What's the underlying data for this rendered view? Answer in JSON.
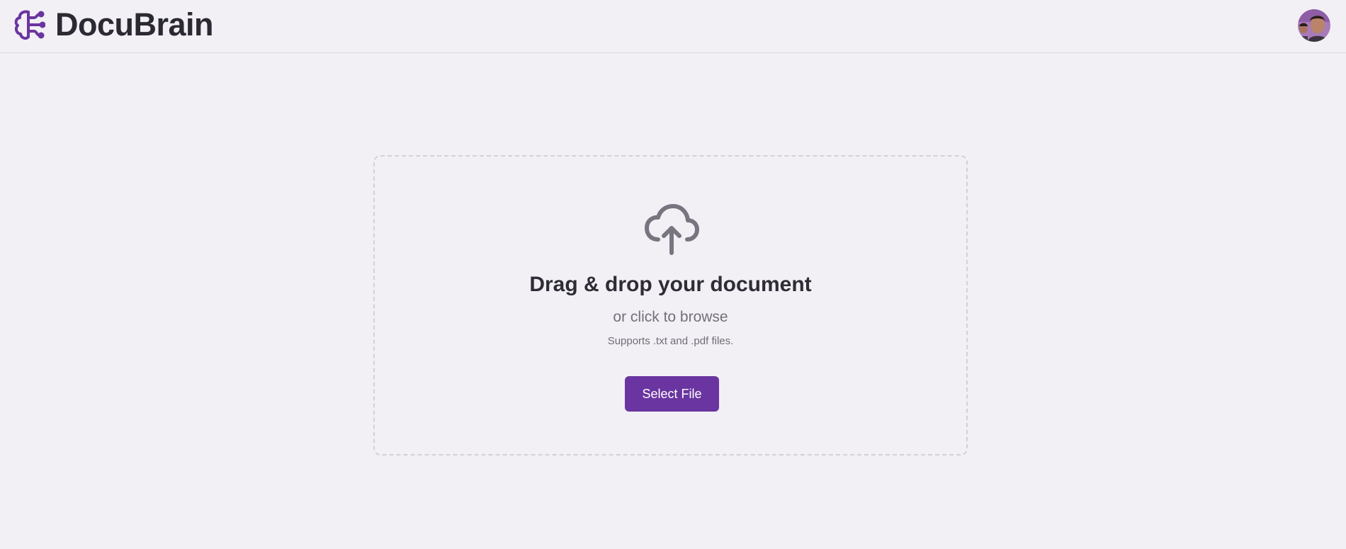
{
  "app": {
    "name": "DocuBrain",
    "logo_icon": "brain-icon",
    "brand_color": "#6a35a0"
  },
  "header": {
    "avatar_icon": "user-avatar"
  },
  "upload": {
    "icon": "cloud-upload-icon",
    "title": "Drag & drop your document",
    "subtitle": "or click to browse",
    "note": "Supports .txt and .pdf files.",
    "button_label": "Select File"
  }
}
